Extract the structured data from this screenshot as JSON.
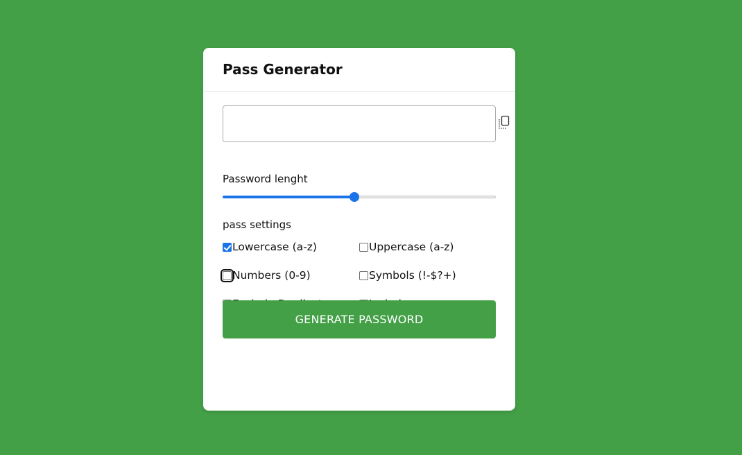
{
  "app": {
    "title": "Pass Generator"
  },
  "output": {
    "value": "",
    "placeholder": "",
    "copy_icon": "copy-icon"
  },
  "length": {
    "label": "Password lenght",
    "slider_fraction": 0.482
  },
  "settings": {
    "label": "pass settings",
    "options": [
      {
        "label": "Lowercase (a-z)",
        "checked": true,
        "focused": false
      },
      {
        "label": "Uppercase (a-z)",
        "checked": false,
        "focused": false
      },
      {
        "label": "Numbers (0-9)",
        "checked": false,
        "focused": true
      },
      {
        "label": "Symbols (!-$?+)",
        "checked": false,
        "focused": false
      },
      {
        "label": "Exclude Duplicate",
        "checked": false,
        "focused": false
      },
      {
        "label": "Include spaces",
        "checked": false,
        "focused": false
      }
    ]
  },
  "generate_button": {
    "label": "GENERATE PASSWORD"
  },
  "colors": {
    "background": "#43a047",
    "card": "#ffffff",
    "accent": "#1a73e8",
    "button": "#43a047"
  }
}
